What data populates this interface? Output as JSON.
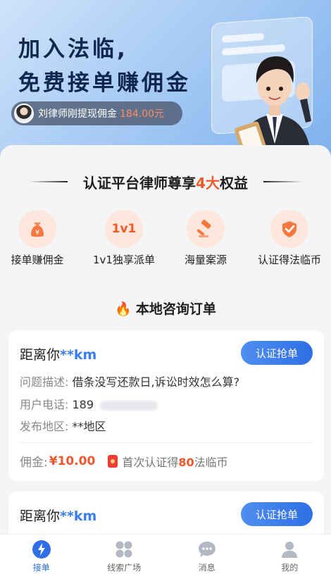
{
  "hero": {
    "line1": "加入法临,",
    "line2": "免费接单赚佣金",
    "notice_text": "刘律师刚提现佣金",
    "notice_amount": "184.00元"
  },
  "benefits": {
    "title_pre": "认证平台律师尊享",
    "title_hl": "4大",
    "title_post": "权益",
    "items": [
      {
        "label": "接单赚佣金",
        "icon": "money-bag-icon",
        "glyph": "¥"
      },
      {
        "label": "1v1独享派单",
        "icon": "1v1-icon",
        "glyph": "1v1"
      },
      {
        "label": "海量案源",
        "icon": "gavel-icon"
      },
      {
        "label": "认证得法临币",
        "icon": "shield-check-icon"
      }
    ]
  },
  "orders": {
    "title": "本地咨询订单",
    "cards": [
      {
        "dist_pre": "距离你",
        "dist_km": "**km",
        "action": "认证抢单",
        "desc_key": "问题描述:",
        "desc_val": "借条没写还款日,诉讼时效怎么算?",
        "phone_key": "用户电话:",
        "phone_val": "189",
        "area_key": "发布地区:",
        "area_val": "**地区",
        "fee_key": "佣金:",
        "fee_val": "¥10.00",
        "bonus_pre": "首次认证得",
        "bonus_num": "80",
        "bonus_post": "法临币"
      },
      {
        "dist_pre": "距离你",
        "dist_km": "**km",
        "action": "认证抢单"
      }
    ]
  },
  "tabbar": {
    "items": [
      {
        "label": "接单",
        "icon": "lightning-icon",
        "active": true
      },
      {
        "label": "线索广场",
        "icon": "grid-icon",
        "active": false
      },
      {
        "label": "消息",
        "icon": "chat-bubble-icon",
        "active": false
      },
      {
        "label": "我的",
        "icon": "person-icon",
        "active": false
      }
    ]
  },
  "colors": {
    "accent": "#2f6fe6",
    "highlight": "#f05a28",
    "hero_bg": "#a9ccf4"
  }
}
